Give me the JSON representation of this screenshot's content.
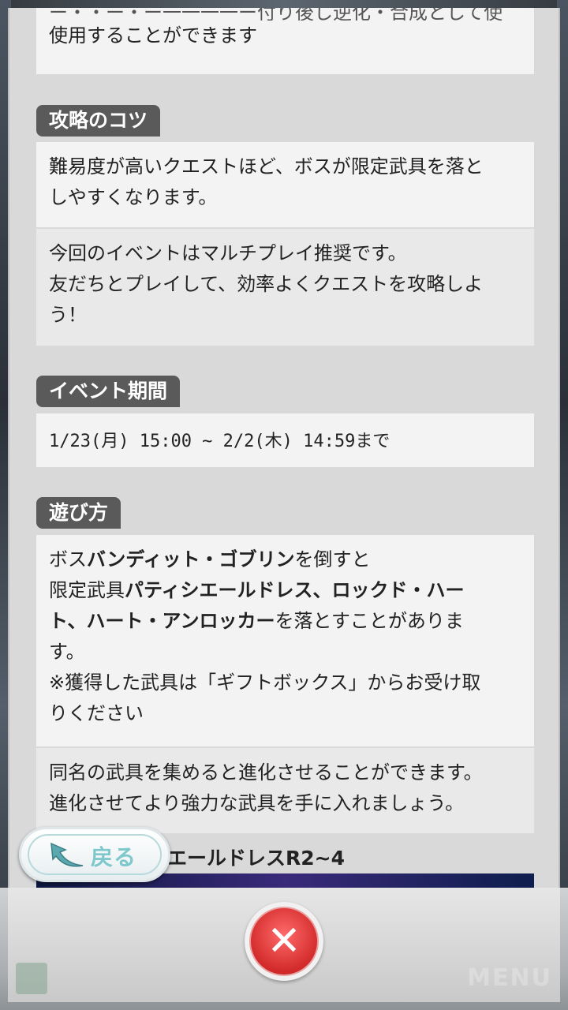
{
  "top_fragment": {
    "line1": "使用することができます",
    "line0_partial": "ー・・ー・ー一一一一ー付り後し逆化・合成として使"
  },
  "section_tips": {
    "label": "攻略のコツ",
    "block1": [
      "難易度が高いクエストほど、ボスが限定武具を落と",
      "しやすくなります。"
    ],
    "block2": [
      "今回のイベントはマルチプレイ推奨です。",
      "友だちとプレイして、効率よくクエストを攻略しよ",
      "う！"
    ]
  },
  "section_period": {
    "label": "イベント期間",
    "text": "1/23(月) 15:00 ~ 2/2(木) 14:59まで"
  },
  "section_howto": {
    "label": "遊び方",
    "l1_pre": "ボス",
    "l1_bold": "バンディット・ゴブリン",
    "l1_post": "を倒すと",
    "l2_pre": "限定武具",
    "l2_bold": "パティシエールドレス、ロックド・ハー",
    "l3_bold": "ト、ハート・アンロッカー",
    "l3_post": "を落とすことがありま",
    "l4": "す。",
    "l5": "※獲得した武具は「ギフトボックス」からお受け取",
    "l6": "りください",
    "block2": [
      "同名の武具を集めると進化させることができます。",
      "進化させてより強力な武具を手に入れましょう。"
    ],
    "sub_heading": "エールドレスR2~4"
  },
  "back_button": {
    "label": "戻る"
  },
  "close_button": {
    "label": "✕"
  },
  "footer": {
    "menu_ghost": "MENU"
  }
}
